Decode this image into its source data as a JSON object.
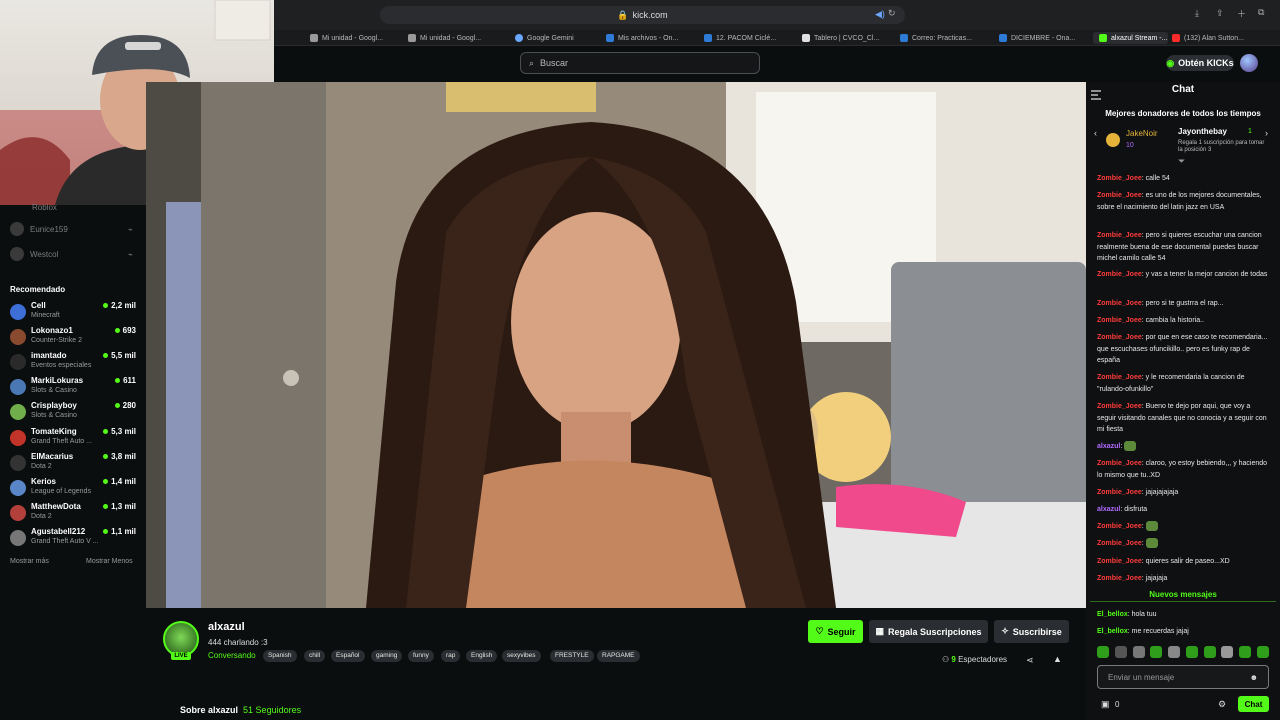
{
  "browser": {
    "url": "kick.com",
    "tabs": [
      {
        "label": "Mi unidad - Googl..."
      },
      {
        "label": "Mi unidad - Googl..."
      },
      {
        "label": "Google Gemini"
      },
      {
        "label": "Mis archivos - On..."
      },
      {
        "label": "12. PACOM Ciclé..."
      },
      {
        "label": "Tablero | CVCO_Cl..."
      },
      {
        "label": "Correo: Practicas..."
      },
      {
        "label": "DICIEMBRE - Ona..."
      },
      {
        "label": "alxazul Stream -..."
      },
      {
        "label": "(132) Alan Sutton..."
      }
    ]
  },
  "header": {
    "search_placeholder": "Buscar",
    "kicks_label": "Obtén KICKs"
  },
  "sidebar": {
    "offline": [
      {
        "name": "Roblox"
      },
      {
        "name": "Eunice159"
      },
      {
        "name": "Westcol"
      }
    ],
    "recommended_title": "Recomendado",
    "recommended": [
      {
        "name": "Cell",
        "category": "Minecraft",
        "viewers": "2,2 mil",
        "color": "#3d6fd6"
      },
      {
        "name": "Lokonazo1",
        "category": "Counter-Strike 2",
        "viewers": "693",
        "color": "#8a4a2f"
      },
      {
        "name": "imantado",
        "category": "Eventos especiales",
        "viewers": "5,5 mil",
        "color": "#2a2a2a"
      },
      {
        "name": "MarkiLokuras",
        "category": "Slots & Casino",
        "viewers": "611",
        "color": "#4a78b5"
      },
      {
        "name": "Crisplayboy",
        "category": "Slots & Casino",
        "viewers": "280",
        "color": "#6fae4a"
      },
      {
        "name": "TomateKing",
        "category": "Grand Theft Auto ...",
        "viewers": "5,3 mil",
        "color": "#c2332a"
      },
      {
        "name": "ElMacarius",
        "category": "Dota 2",
        "viewers": "3,8 mil",
        "color": "#333333"
      },
      {
        "name": "Kerios",
        "category": "League of Legends",
        "viewers": "1,4 mil",
        "color": "#5a86c7"
      },
      {
        "name": "MatthewDota",
        "category": "Dota 2",
        "viewers": "1,3 mil",
        "color": "#b3403b"
      },
      {
        "name": "Agustabell212",
        "category": "Grand Theft Auto V ...",
        "viewers": "1,1 mil",
        "color": "#777777"
      }
    ],
    "show_more": "Mostrar más",
    "show_less": "Mostrar Menos"
  },
  "channel": {
    "name": "alxazul",
    "live_badge": "LIVE",
    "viewers_line": "444 charlando :3",
    "category": "Conversando",
    "tags": [
      "Spanish",
      "chill",
      "Español",
      "gaming",
      "funny",
      "rap",
      "English",
      "sexyvibes",
      "FRESTYLE",
      "RAPGAME"
    ],
    "follow_label": "Seguir",
    "gift_label": "Regala Suscripciones",
    "subscribe_label": "Suscribirse",
    "viewer_count": "9",
    "viewer_suffix": "Espectadores",
    "about_label": "Sobre alxazul",
    "followers": "51 Seguidores"
  },
  "chat": {
    "title": "Chat",
    "donors_title": "Mejores donadores de todos los tiempos",
    "donor1": {
      "name": "JakeNoir",
      "value": "10"
    },
    "donor2": {
      "name": "Jayonthebay",
      "value": "1"
    },
    "donor_hint": "Regala 1 suscripción para tomar la posición 3",
    "messages": [
      {
        "user": "Zombie_Joee",
        "text": "calle 54"
      },
      {
        "user": "Zombie_Joee",
        "text": "es uno de los mejores documentales, sobre el nacimiento del latin jazz en USA"
      },
      {
        "user": "Zombie_Joee",
        "text": "pero si quieres escuchar una cancion realmente buena de ese documental puedes buscar michel camilo calle 54"
      },
      {
        "user": "Zombie_Joee",
        "text": "y vas a tener la mejor cancion de todas"
      },
      {
        "user": "Zombie_Joee",
        "text": "pero si te gustrra el rap..."
      },
      {
        "user": "Zombie_Joee",
        "text": "cambia la historia.."
      },
      {
        "user": "Zombie_Joee",
        "text": "por que en ese caso te recomendaria... que escuchases ofuncikillo.. pero es funky rap de españa"
      },
      {
        "user": "Zombie_Joee",
        "text": "y le recomendaria la cancion de \"rulando-ofunkillo\""
      },
      {
        "user": "Zombie_Joee",
        "text": "Bueno te dejo por aqui, que voy a seguir visitando canales que no conocia y a seguir con mi fiesta"
      },
      {
        "user": "alxazul",
        "text": ""
      },
      {
        "user": "Zombie_Joee",
        "text": "claroo, yo estoy bebiendo,,, y haciendo lo mismo que tu..XD"
      },
      {
        "user": "Zombie_Joee",
        "text": "jajajajajaja"
      },
      {
        "user": "alxazul",
        "text": "disfruta"
      },
      {
        "user": "Zombie_Joee",
        "text": ""
      },
      {
        "user": "Zombie_Joee",
        "text": ""
      },
      {
        "user": "Zombie_Joee",
        "text": "quieres salir de paseo...XD"
      },
      {
        "user": "Zombie_Joee",
        "text": "jajajaja"
      }
    ],
    "new_messages": "Nuevos mensajes",
    "new": [
      {
        "user": "El_bellox",
        "text": "hola tuu"
      },
      {
        "user": "El_bellox",
        "text": "me recuerdas jajaj"
      }
    ],
    "input_placeholder": "Enviar un mensaje",
    "points": "0",
    "send_label": "Chat"
  },
  "colors": {
    "accent": "#53fc18",
    "chat_user": "#ff3b3b",
    "streamer": "#b36bff"
  }
}
